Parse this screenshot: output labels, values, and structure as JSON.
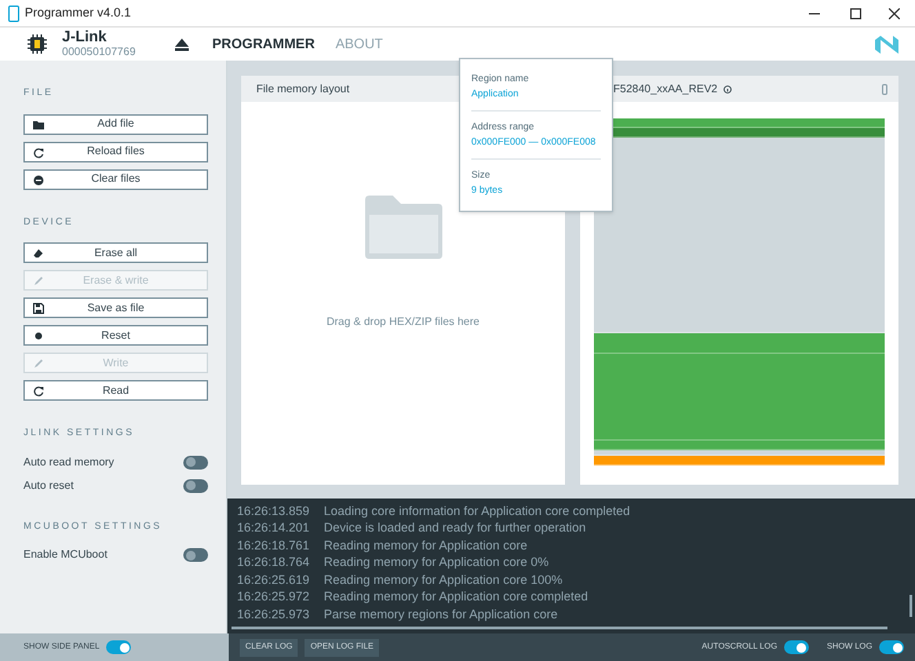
{
  "window": {
    "title": "Programmer v4.0.1"
  },
  "device": {
    "name": "J-Link",
    "serial": "000050107769"
  },
  "nav": [
    {
      "label": "PROGRAMMER",
      "selected": true
    },
    {
      "label": "ABOUT",
      "selected": false
    }
  ],
  "sidebar": {
    "sections": [
      {
        "title": "FILE",
        "items": [
          {
            "kind": "button",
            "label": "Add file",
            "disabled": false
          },
          {
            "kind": "button",
            "label": "Reload files",
            "disabled": false
          },
          {
            "kind": "button",
            "label": "Clear files",
            "disabled": false
          }
        ]
      },
      {
        "title": "DEVICE",
        "items": [
          {
            "kind": "button",
            "label": "Erase all",
            "disabled": false
          },
          {
            "kind": "button",
            "label": "Erase & write",
            "disabled": true
          },
          {
            "kind": "button",
            "label": "Save as file",
            "disabled": false
          },
          {
            "kind": "button",
            "label": "Reset",
            "disabled": false
          },
          {
            "kind": "button",
            "label": "Write",
            "disabled": true
          },
          {
            "kind": "button",
            "label": "Read",
            "disabled": false
          }
        ]
      },
      {
        "title": "JLINK SETTINGS",
        "items": [
          {
            "kind": "toggle",
            "label": "Auto read memory",
            "on": false
          },
          {
            "kind": "toggle",
            "label": "Auto reset",
            "on": false
          }
        ]
      },
      {
        "title": "MCUBOOT SETTINGS",
        "items": [
          {
            "kind": "toggle",
            "label": "Enable MCUboot",
            "on": false
          }
        ]
      }
    ]
  },
  "file_panel": {
    "title": "File memory layout",
    "hint": "Drag & drop HEX/ZIP files here"
  },
  "device_panel": {
    "title": "F52840_xxAA_REV2",
    "memory_regions": [
      {
        "color": "#4caf50"
      },
      {
        "color": "#388e3c"
      },
      {
        "color": "#cfd8dc"
      },
      {
        "color": "#4caf50"
      },
      {
        "color": "#4caf50"
      },
      {
        "color": "#4caf50"
      },
      {
        "color": "#cfd8dc"
      },
      {
        "color": "#ff9800"
      }
    ]
  },
  "tooltip": {
    "fields": [
      {
        "label": "Region name",
        "value": "Application"
      },
      {
        "label": "Address range",
        "value": "0x000FE000 — 0x000FE008"
      },
      {
        "label": "Size",
        "value": "9 bytes"
      }
    ]
  },
  "log": [
    {
      "time": "16:26:13.859",
      "message": "Loading core information for Application core completed"
    },
    {
      "time": "16:26:14.201",
      "message": "Device is loaded and ready for further operation"
    },
    {
      "time": "16:26:18.761",
      "message": "Reading memory for Application core"
    },
    {
      "time": "16:26:18.764",
      "message": "Reading memory for Application core 0%"
    },
    {
      "time": "16:26:25.619",
      "message": "Reading memory for Application core 100%"
    },
    {
      "time": "16:26:25.972",
      "message": "Reading memory for Application core completed"
    },
    {
      "time": "16:26:25.973",
      "message": "Parse memory regions for Application core"
    }
  ],
  "status_bar": {
    "side_panel": {
      "label": "SHOW SIDE PANEL",
      "on": true
    },
    "buttons": [
      "CLEAR LOG",
      "OPEN LOG FILE"
    ],
    "autoscroll": {
      "label": "AUTOSCROLL LOG",
      "on": true
    },
    "show_log": {
      "label": "SHOW LOG",
      "on": true
    }
  }
}
